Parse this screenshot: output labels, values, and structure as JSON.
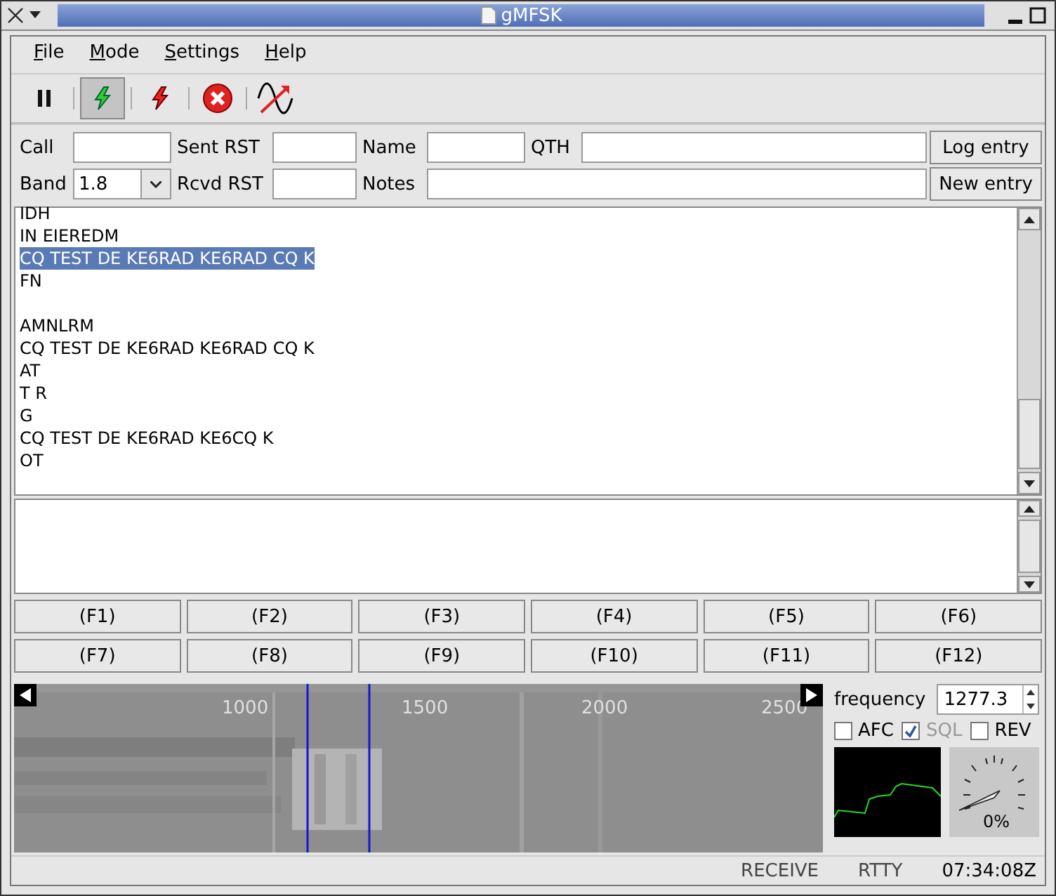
{
  "window": {
    "title": "gMFSK"
  },
  "menu": [
    "File",
    "Mode",
    "Settings",
    "Help"
  ],
  "toolbar": [
    {
      "kind": "pause",
      "selected": false
    },
    {
      "kind": "transmit",
      "selected": true
    },
    {
      "kind": "receive",
      "selected": false
    },
    {
      "kind": "abort",
      "selected": false
    },
    {
      "kind": "sine",
      "selected": false
    }
  ],
  "log_form": {
    "call": {
      "label": "Call"
    },
    "sent_rst": {
      "label": "Sent RST"
    },
    "name": {
      "label": "Name"
    },
    "qth": {
      "label": "QTH"
    },
    "band": {
      "label": "Band",
      "value": "1.8"
    },
    "rcvd_rst": {
      "label": "Rcvd RST"
    },
    "notes": {
      "label": "Notes"
    },
    "log_button": "Log entry",
    "new_button": "New entry"
  },
  "receive_text": [
    {
      "lines": [
        {
          "text": "IDH",
          "selected": false
        },
        {
          "text": "IN EIEREDM",
          "selected": false
        },
        {
          "text": "CQ TEST DE KE6RAD KE6RAD CQ K",
          "selected": true
        },
        {
          "text": "FN",
          "selected": false
        }
      ]
    },
    {
      "lines": [
        {
          "text": "AMNLRM",
          "selected": false
        },
        {
          "text": "CQ TEST DE KE6RAD KE6RAD CQ K",
          "selected": false
        },
        {
          "text": "AT",
          "selected": false
        },
        {
          "text": "T R",
          "selected": false
        },
        {
          "text": "G",
          "selected": false
        },
        {
          "text": "CQ TEST DE KE6RAD KE6CQ K",
          "selected": false
        },
        {
          "text": "OT",
          "selected": false
        }
      ]
    }
  ],
  "function_keys": [
    "(F1)",
    "(F2)",
    "(F3)",
    "(F4)",
    "(F5)",
    "(F6)",
    "(F7)",
    "(F8)",
    "(F9)",
    "(F10)",
    "(F11)",
    "(F12)"
  ],
  "waterfall": {
    "scale": [
      "1000",
      "1500",
      "2000",
      "2500"
    ]
  },
  "frequency": {
    "label": "frequency",
    "value": "1277.3"
  },
  "options": [
    {
      "label": "AFC",
      "checked": false,
      "disabled": false
    },
    {
      "label": "SQL",
      "checked": true,
      "disabled": true
    },
    {
      "label": "REV",
      "checked": false,
      "disabled": false
    }
  ],
  "meter": {
    "reading": "0%"
  },
  "status_bar": [
    "RECEIVE",
    "RTTY",
    "07:34:08Z"
  ]
}
